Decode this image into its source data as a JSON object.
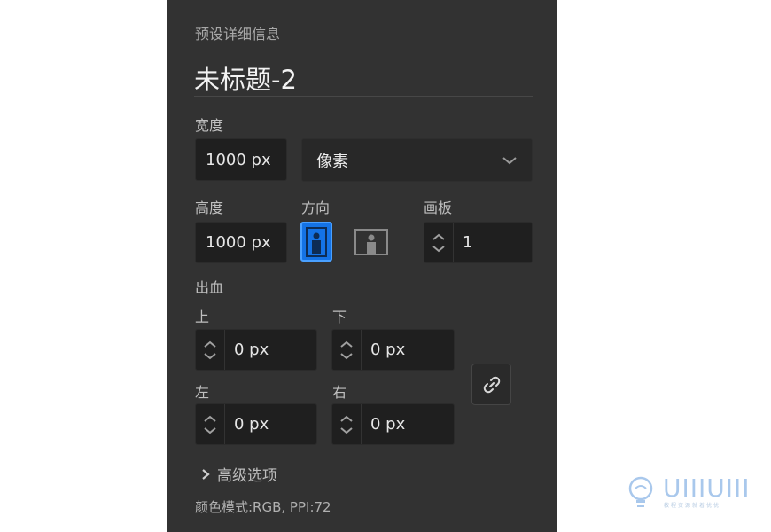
{
  "panel": {
    "section_title": "预设详细信息",
    "document_title": "未标题-2"
  },
  "width": {
    "label": "宽度",
    "value": "1000 px",
    "unit_selected": "像素"
  },
  "height": {
    "label": "高度",
    "value": "1000 px"
  },
  "orientation": {
    "label": "方向",
    "selected": "portrait"
  },
  "artboards": {
    "label": "画板",
    "value": "1"
  },
  "bleed": {
    "label": "出血",
    "top": {
      "label": "上",
      "value": "0 px"
    },
    "bottom": {
      "label": "下",
      "value": "0 px"
    },
    "left": {
      "label": "左",
      "value": "0 px"
    },
    "right": {
      "label": "右",
      "value": "0 px"
    },
    "link_icon": "link-icon"
  },
  "advanced": {
    "label": "高级选项"
  },
  "footer": {
    "info": "颜色模式:RGB, PPI:72"
  },
  "watermark": {
    "text": "UIIIUIII",
    "subtitle": "教程资源就着优优"
  },
  "colors": {
    "panel_bg": "#323232",
    "accent": "#1473e6",
    "field_bg": "#1f1f1f"
  }
}
